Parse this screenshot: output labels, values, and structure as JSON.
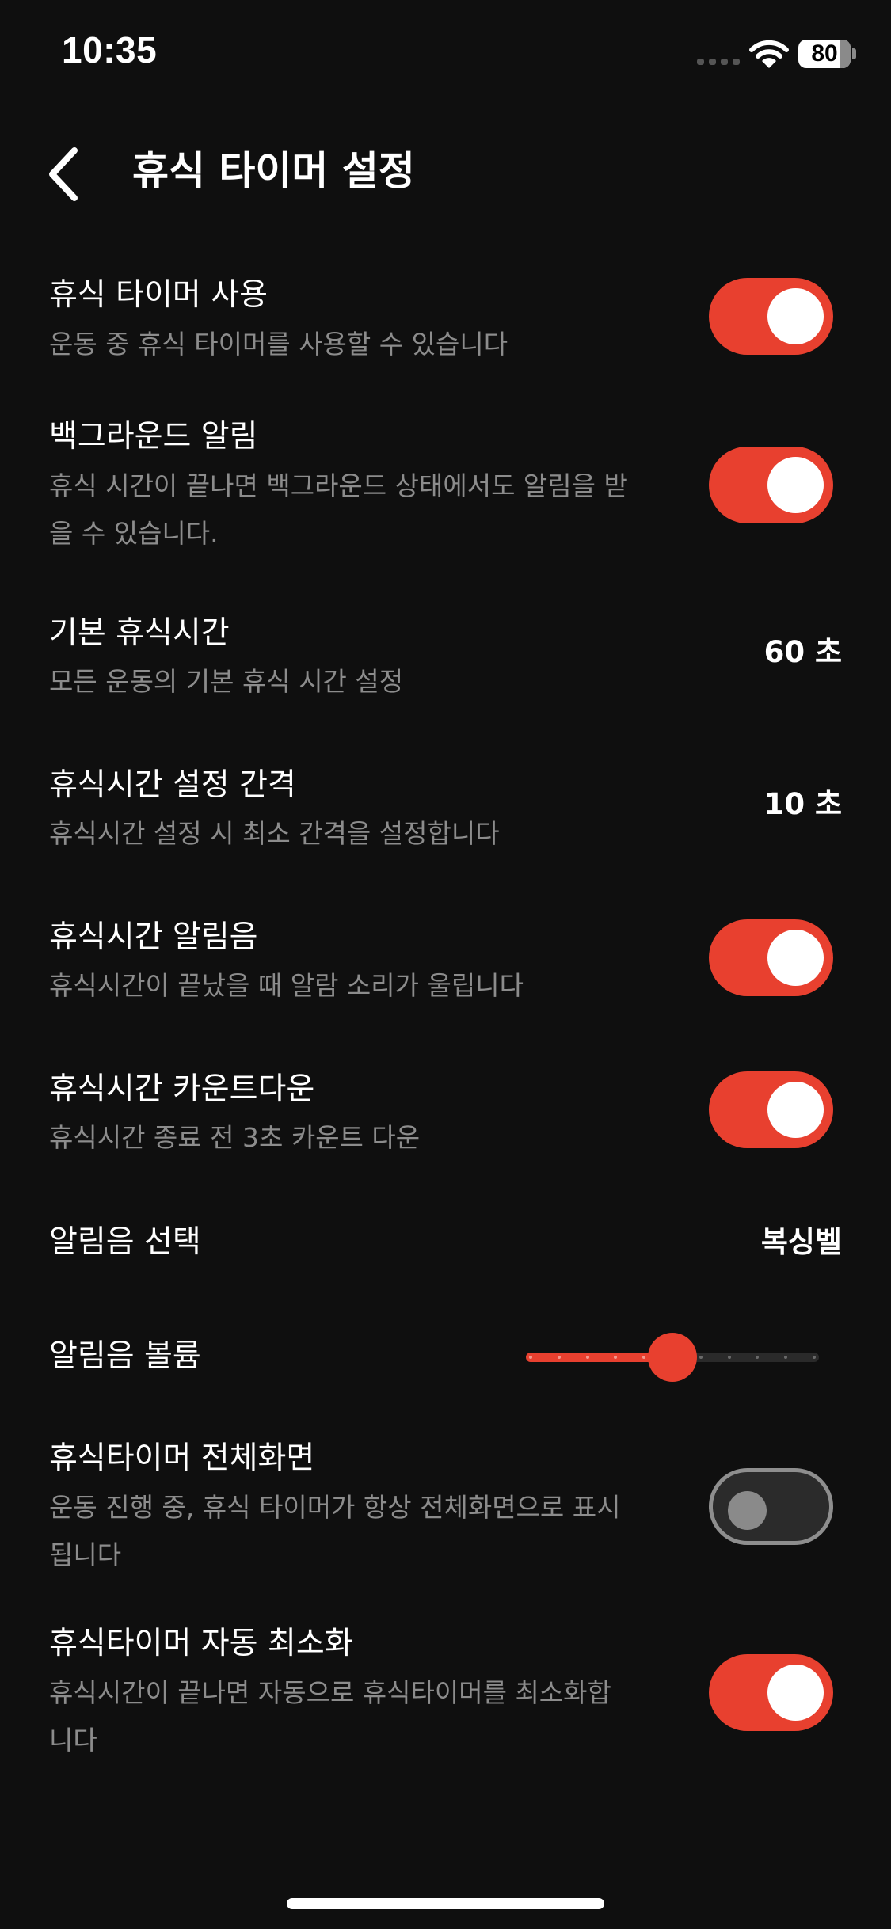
{
  "status_bar": {
    "time": "10:35",
    "battery": "80",
    "battery_level": 0.8,
    "icons": [
      "cellular-signal-icon",
      "wifi-icon",
      "battery-icon"
    ]
  },
  "header": {
    "back_icon": "chevron-left-icon",
    "title": "휴식 타이머 설정"
  },
  "settings": {
    "rest_timer_use": {
      "title": "휴식 타이머 사용",
      "desc_lines": [
        "운동 중 휴식 타이머를 사용할 수 있습니다"
      ],
      "enabled": true
    },
    "background_alarm": {
      "title": "백그라운드 알림",
      "desc_lines": [
        "휴식 시간이 끝나면 백그라운드 상태에서도 알림을 받",
        "을 수 있습니다."
      ],
      "enabled": true
    },
    "default_rest_time": {
      "title": "기본 휴식시간",
      "desc_lines": [
        "모든 운동의 기본 휴식 시간 설정"
      ],
      "value": "60 초"
    },
    "rest_time_interval": {
      "title": "휴식시간 설정 간격",
      "desc_lines": [
        "휴식시간 설정 시 최소 간격을 설정합니다"
      ],
      "value": "10 초"
    },
    "rest_alarm_sound": {
      "title": "휴식시간 알림음",
      "desc_lines": [
        "휴식시간이 끝났을 때 알람 소리가 울립니다"
      ],
      "enabled": true
    },
    "rest_countdown": {
      "title": "휴식시간 카운트다운",
      "desc_lines": [
        "휴식시간 종료 전 3초 카운트 다운"
      ],
      "enabled": true
    },
    "alarm_sound_select": {
      "title": "알림음 선택",
      "value": "복싱벨"
    },
    "alarm_volume": {
      "title": "알림음 볼륨",
      "level": 0.5
    },
    "fullscreen_timer": {
      "title": "휴식타이머 전체화면",
      "desc_lines": [
        "운동 진행 중, 휴식 타이머가 항상 전체화면으로 표시",
        "됩니다"
      ],
      "enabled": false
    },
    "auto_minimize": {
      "title": "휴식타이머 자동 최소화",
      "desc_lines": [
        "휴식시간이 끝나면 자동으로 휴식타이머를 최소화합",
        "니다"
      ],
      "enabled": true
    }
  },
  "colors": {
    "background": "#0f0f0f",
    "accent": "#e8402f",
    "secondary_text": "#8c8c8c",
    "toggle_off": "#2b2b2b"
  }
}
